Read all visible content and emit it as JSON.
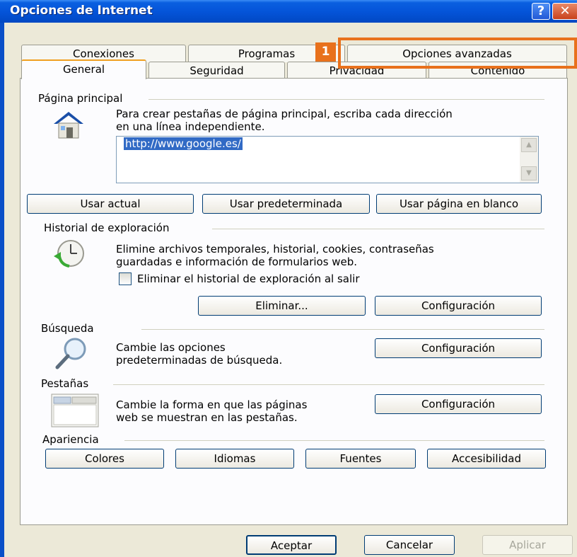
{
  "window": {
    "title": "Opciones de Internet",
    "help_glyph": "?",
    "close_glyph": "✕"
  },
  "tabs_row1": [
    "Conexiones",
    "Programas",
    "Opciones avanzadas"
  ],
  "tabs_row2": [
    "General",
    "Seguridad",
    "Privacidad",
    "Contenido"
  ],
  "active_tab": "General",
  "callout": {
    "number": "1",
    "color": "#e8711c"
  },
  "home": {
    "label": "Página principal",
    "description_line1": "Para crear pestañas de página principal, escriba cada dirección",
    "description_line2": "en una línea independiente.",
    "url": "http://www.google.es/",
    "buttons": [
      "Usar actual",
      "Usar predeterminada",
      "Usar página en blanco"
    ],
    "icon": "house-icon"
  },
  "history": {
    "label": "Historial de exploración",
    "description_line1": "Elimine archivos temporales, historial, cookies, contraseñas",
    "description_line2": "guardadas e información de formularios web.",
    "checkbox_label": "Eliminar el historial de exploración al salir",
    "checkbox_checked": false,
    "delete_button": "Eliminar...",
    "settings_button": "Configuración",
    "icon": "clock-icon"
  },
  "search": {
    "label": "Búsqueda",
    "description_line1": "Cambie las opciones",
    "description_line2": "predeterminadas de búsqueda.",
    "settings_button": "Configuración",
    "icon": "magnifier-icon"
  },
  "tabs_section": {
    "label": "Pestañas",
    "description_line1": "Cambie la forma en que las páginas",
    "description_line2": "web se muestran en las pestañas.",
    "settings_button": "Configuración",
    "icon": "tabs-window-icon"
  },
  "appearance": {
    "label": "Apariencia",
    "buttons": [
      "Colores",
      "Idiomas",
      "Fuentes",
      "Accesibilidad"
    ]
  },
  "footer": {
    "ok": "Aceptar",
    "cancel": "Cancelar",
    "apply": "Aplicar"
  }
}
